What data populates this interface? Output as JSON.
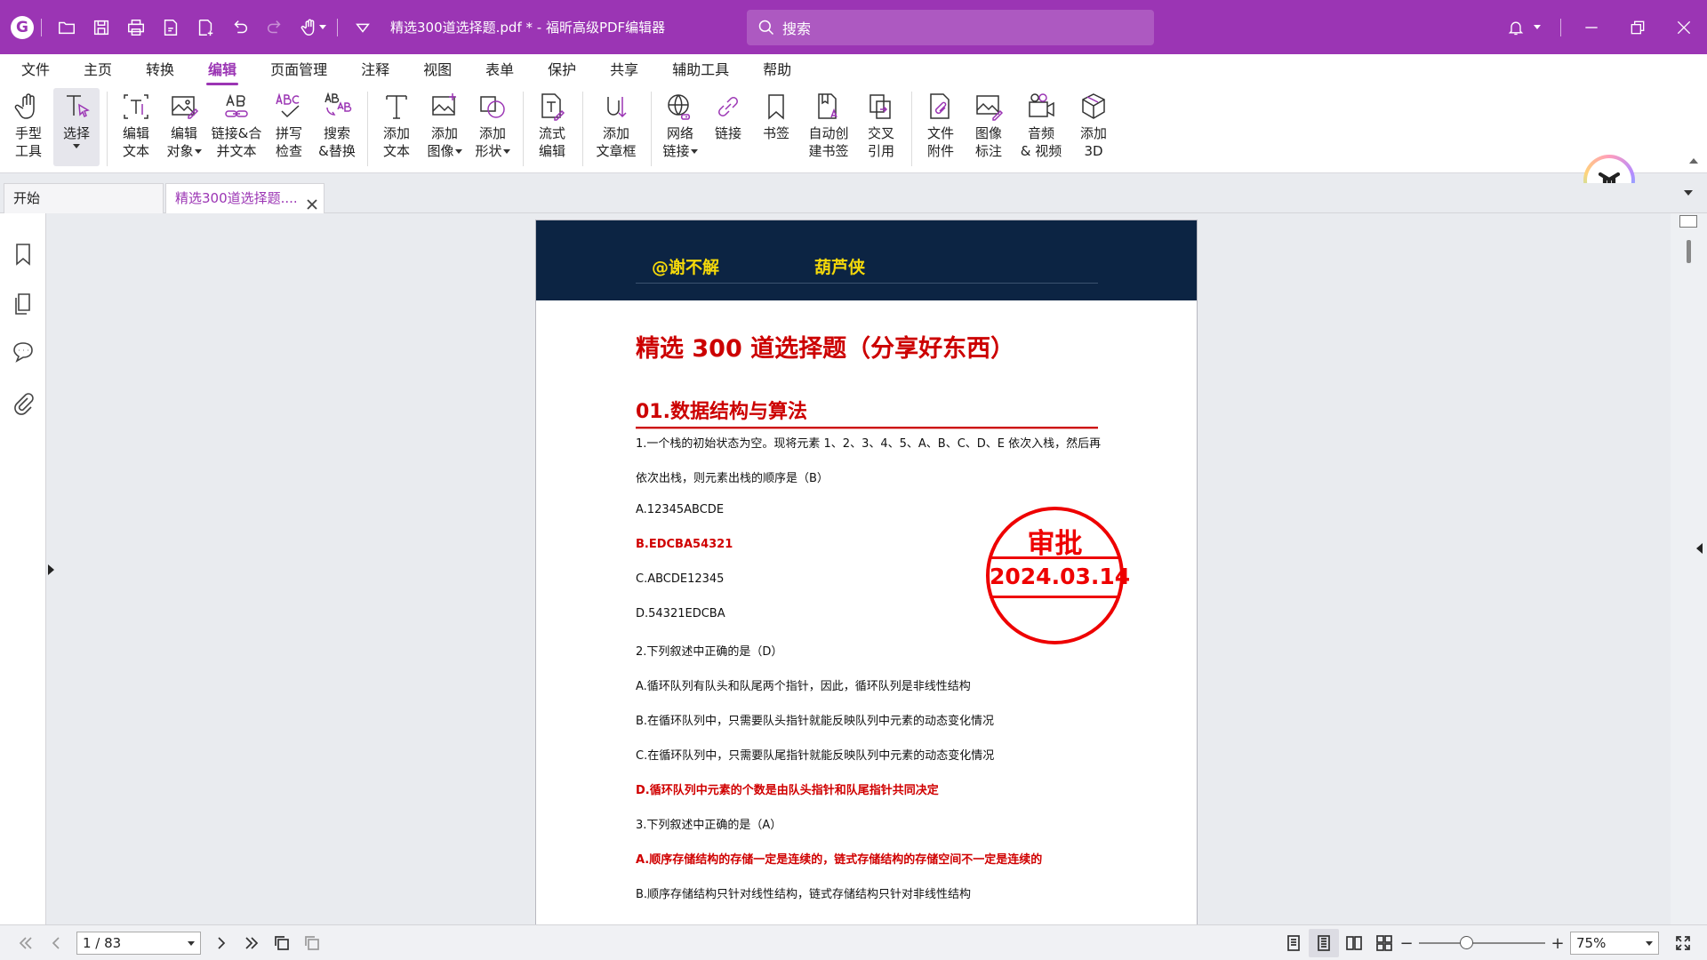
{
  "app": {
    "window_title": "精选300道选择题.pdf * - 福昕高级PDF编辑器",
    "logo_glyph": "G",
    "search_placeholder": "搜索",
    "brand_color": "#9b35b4"
  },
  "menu": {
    "tabs": [
      "文件",
      "主页",
      "转换",
      "编辑",
      "页面管理",
      "注释",
      "视图",
      "表单",
      "保护",
      "共享",
      "辅助工具",
      "帮助"
    ],
    "active": "编辑"
  },
  "ribbon": {
    "hand_tool": "手型\n工具",
    "select": "选择",
    "edit_text": "编辑\n文本",
    "edit_object_1": "编辑",
    "edit_object_2": "对象",
    "link_merge": "链接&合\n并文本",
    "spell_check": "拼写\n检查",
    "search_replace": "搜索\n&替换",
    "add_text": "添加\n文本",
    "add_image_1": "添加",
    "add_image_2": "图像",
    "add_shape_1": "添加",
    "add_shape_2": "形状",
    "flow_edit": "流式\n编辑",
    "add_article": "添加\n文章框",
    "web_link_1": "网络",
    "web_link_2": "链接",
    "link": "链接",
    "bookmark": "书签",
    "auto_bookmark": "自动创\n建书签",
    "cross_ref": "交叉\n引用",
    "file_attach": "文件\n附件",
    "image_mark": "图像\n标注",
    "audio_video": "音频\n& 视频",
    "add_3d": "添加\n3D"
  },
  "tabs": {
    "home": "开始",
    "document": "精选300道选择题...."
  },
  "document": {
    "header_author": "@谢不解",
    "header_name": "葫芦侠",
    "title": "精选 300 道选择题（分享好东西）",
    "section": "01.数据结构与算法",
    "lines": [
      {
        "text": "1.一个栈的初始状态为空。现将元素 1、2、3、4、5、A、B、C、D、E 依次入栈，然后再",
        "red": false
      },
      {
        "text": "依次出栈，则元素出栈的顺序是（B）",
        "red": false
      },
      {
        "text": "A.12345ABCDE",
        "red": false
      },
      {
        "text": "B.EDCBA54321",
        "red": true
      },
      {
        "text": "C.ABCDE12345",
        "red": false
      },
      {
        "text": "D.54321EDCBA",
        "red": false
      },
      {
        "text": "2.下列叙述中正确的是（D）",
        "red": false
      },
      {
        "text": "A.循环队列有队头和队尾两个指针，因此，循环队列是非线性结构",
        "red": false
      },
      {
        "text": "B.在循环队列中，只需要队头指针就能反映队列中元素的动态变化情况",
        "red": false
      },
      {
        "text": "C.在循环队列中，只需要队尾指针就能反映队列中元素的动态变化情况",
        "red": false
      },
      {
        "text": "D.循环队列中元素的个数是由队头指针和队尾指针共同决定",
        "red": true
      },
      {
        "text": "3.下列叙述中正确的是（A）",
        "red": false
      },
      {
        "text": "A.顺序存储结构的存储一定是连续的，链式存储结构的存储空间不一定是连续的",
        "red": true
      },
      {
        "text": "B.顺序存储结构只针对线性结构，链式存储结构只针对非线性结构",
        "red": false
      }
    ],
    "stamp_top": "审批",
    "stamp_date": "2024.03.14",
    "stamp_color": "#e00000"
  },
  "status": {
    "page_indicator": "1 / 83",
    "zoom": "75%",
    "zoom_minus": "−",
    "zoom_plus": "+"
  }
}
